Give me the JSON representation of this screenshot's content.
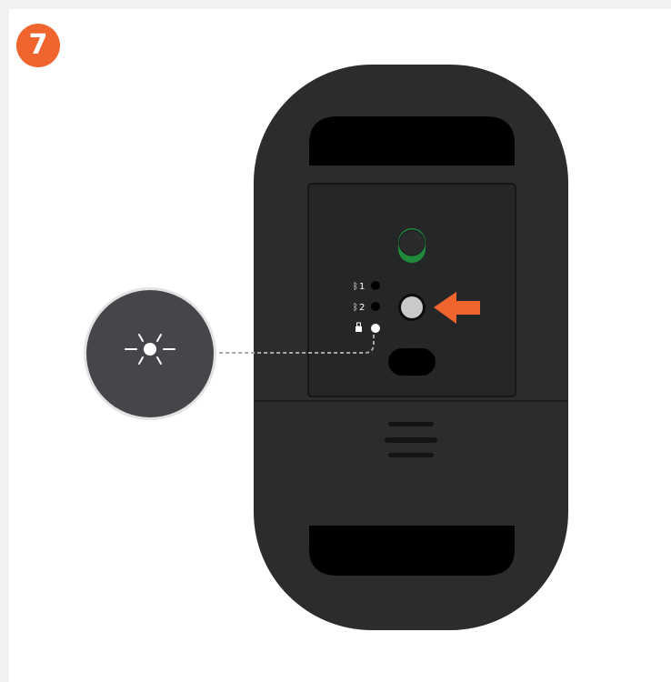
{
  "step": {
    "number": "7"
  },
  "colors": {
    "badge": "#f0642e",
    "arrow": "#f0642e",
    "mouse_body": "#2b2c2e",
    "switch_on": "#1f8a3a",
    "led_on": "#ffffff",
    "connect_button": "#c9c9c9",
    "zoom_circle": "#45464a"
  },
  "channels": [
    {
      "icon": "bluetooth-icon",
      "label": "1",
      "led": "off"
    },
    {
      "icon": "bluetooth-icon",
      "label": "2",
      "led": "off"
    },
    {
      "icon": "receiver-icon",
      "label": "",
      "led": "on"
    }
  ],
  "power_switch": {
    "state": "on"
  },
  "callout": {
    "icon": "blinking-light-icon",
    "meaning": "led blinking"
  }
}
